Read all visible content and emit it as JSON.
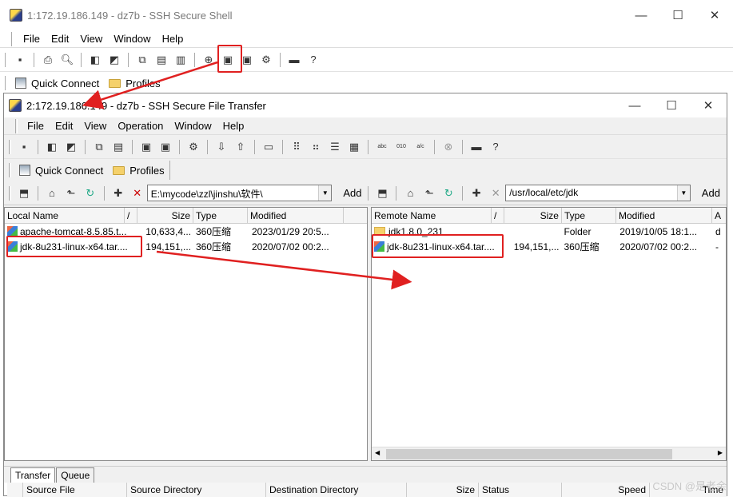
{
  "outer": {
    "title": "1:172.19.186.149 - dz7b - SSH Secure Shell",
    "menu": [
      "File",
      "Edit",
      "View",
      "Window",
      "Help"
    ],
    "quick_connect": "Quick Connect",
    "profiles": "Profiles"
  },
  "inner": {
    "title": "2:172.19.186.149 - dz7b - SSH Secure File Transfer",
    "menu": [
      "File",
      "Edit",
      "View",
      "Operation",
      "Window",
      "Help"
    ],
    "quick_connect": "Quick Connect",
    "profiles": "Profiles",
    "local_path": "E:\\mycode\\zzl\\jinshu\\软件\\",
    "remote_path": "/usr/local/etc/jdk",
    "add_label": "Add",
    "local": {
      "columns": [
        "Local Name",
        "/",
        "Size",
        "Type",
        "Modified"
      ],
      "rows": [
        {
          "name": "apache-tomcat-8.5.85.t...",
          "size": "10,633,4...",
          "type": "360压缩",
          "modified": "2023/01/29 20:5..."
        },
        {
          "name": "jdk-8u231-linux-x64.tar....",
          "size": "194,151,...",
          "type": "360压缩",
          "modified": "2020/07/02 00:2..."
        }
      ]
    },
    "remote": {
      "columns": [
        "Remote Name",
        "/",
        "Size",
        "Type",
        "Modified",
        "A"
      ],
      "rows": [
        {
          "name": "jdk1.8.0_231",
          "size": "",
          "type": "Folder",
          "modified": "2019/10/05 18:1...",
          "attr": "d"
        },
        {
          "name": "jdk-8u231-linux-x64.tar....",
          "size": "194,151,...",
          "type": "360压缩",
          "modified": "2020/07/02 00:2...",
          "attr": "-"
        }
      ]
    },
    "tabs": [
      "Transfer",
      "Queue"
    ],
    "transfer_columns": [
      "Source File",
      "Source Directory",
      "Destination Directory",
      "Size",
      "Status",
      "Speed",
      "Time"
    ]
  },
  "watermark": "CSDN @是老余",
  "accent": "#e02020"
}
